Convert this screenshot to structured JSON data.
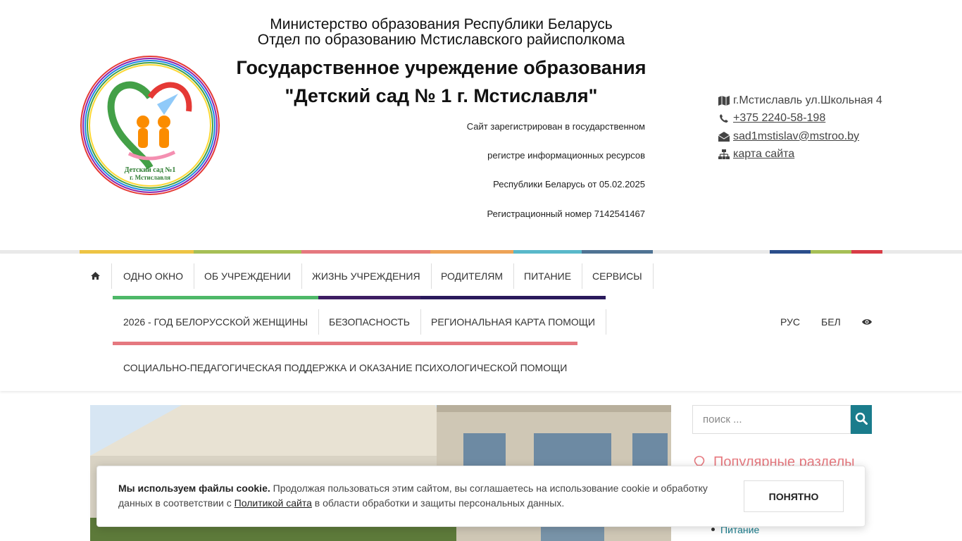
{
  "header": {
    "ministry_line1": "Министерство образования Республики Беларусь",
    "ministry_line2": "Отдел по образованию Мстиславского райисполкома",
    "institution_line1": "Государственное учреждение образования",
    "institution_line2": "\"Детский сад № 1 г. Мстиславля\"",
    "registration": [
      "Сайт зарегистрирован в государственном",
      "регистре информационных ресурсов",
      "Республики Беларусь от 05.02.2025",
      "Регистрационный номер  7142541467"
    ],
    "logo_text_line1": "Детский сад №1",
    "logo_text_line2": "г. Мстиславля"
  },
  "contacts": {
    "address": "г.Мстиславль ул.Школьная 4",
    "phone": "+375 2240-58-198",
    "email": "sad1mstislav@mstroo.by",
    "sitemap": "карта сайта"
  },
  "nav": {
    "row1": [
      "Одно окно",
      "Об учреждении",
      "Жизнь учреждения",
      "Родителям",
      "Питание",
      "Сервисы"
    ],
    "row2": [
      "2026 - Год белорусской женщины",
      "Безопасность",
      "Региональная карта помощи"
    ],
    "row3": [
      "Социально-педагогическая поддержка и оказание психологической помощи"
    ],
    "lang_ru": "РУС",
    "lang_be": "БЕЛ"
  },
  "colors": {
    "accent": "#1a7c8c",
    "yellow": "#edc444",
    "olive": "#a6bf56",
    "pink": "#e5787f",
    "orange": "#eda357",
    "cyan": "#59b8ca",
    "slate": "#4f7393",
    "navy": "#2b4e8c",
    "red": "#d83c46",
    "green": "#4eb868",
    "purple": "#3e1e63"
  },
  "search": {
    "placeholder": "поиск ..."
  },
  "sidebar": {
    "popular_title": "Популярные разделы",
    "items": [
      "Питание"
    ]
  },
  "cookie": {
    "bold": "Мы используем файлы cookie.",
    "text": " Продолжая пользоваться этим сайтом, вы соглашаетесь на использование cookie и обработку данных в соответствии с ",
    "link": "Политикой сайта",
    "text_after": " в области обработки и защиты персональных данных.",
    "button": "ПОНЯТНО"
  }
}
